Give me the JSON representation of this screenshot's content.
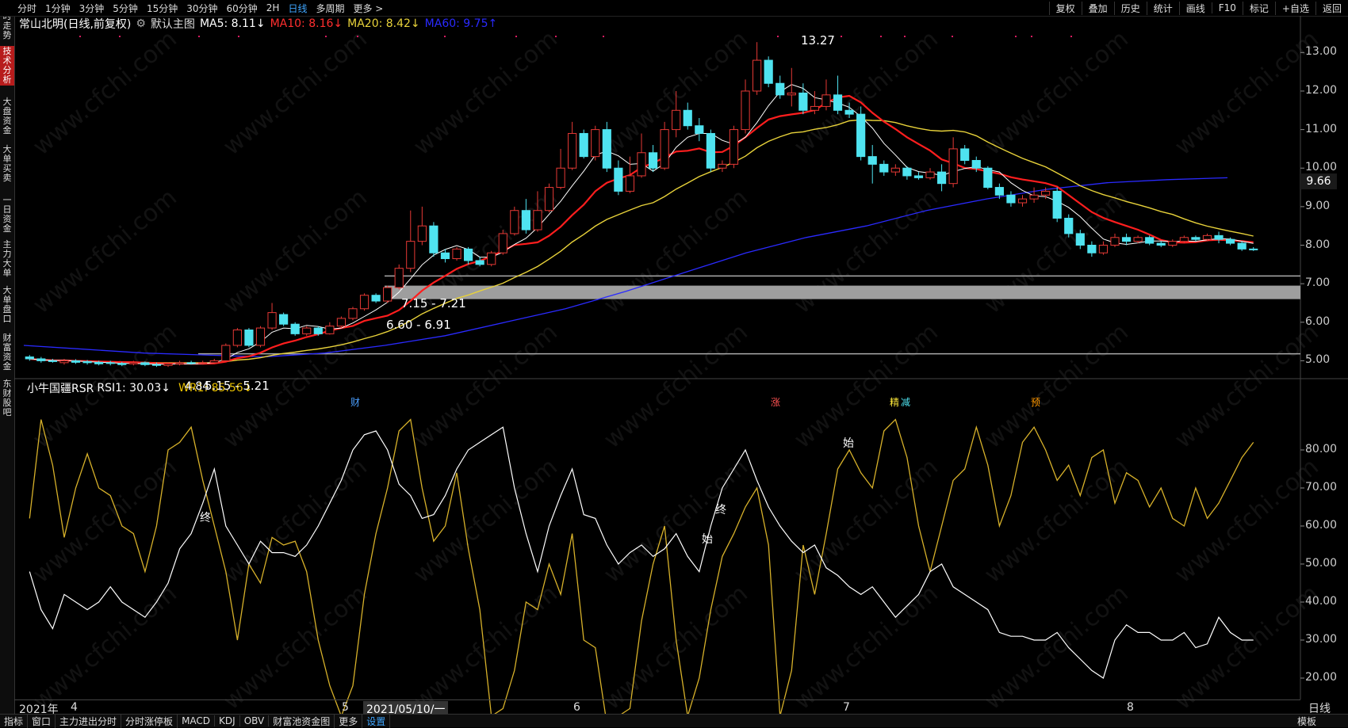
{
  "toolbar": {
    "periods": [
      "分时",
      "1分钟",
      "3分钟",
      "5分钟",
      "15分钟",
      "30分钟",
      "60分钟",
      "2H",
      "日线",
      "多周期",
      "更多 >"
    ],
    "active_period": "日线",
    "right_buttons": [
      "复权",
      "叠加",
      "历史",
      "统计",
      "画线",
      "F10",
      "标记",
      "+自选",
      "返回"
    ]
  },
  "left_tabs": [
    "分时走势",
    "技术分析",
    "大盘资金",
    "大单买卖",
    "一日资金",
    "主力大单",
    "大单盘口",
    "财富资金",
    "东财股吧"
  ],
  "left_tab_active": "技术分析",
  "info": {
    "stock": "常山北明(日线,前复权)",
    "main_chart": "默认主图",
    "ma5": "MA5: 8.11↓",
    "ma10": "MA10: 8.16↓",
    "ma20": "MA20: 8.42↓",
    "ma60": "MA60: 9.75↑"
  },
  "indicator_info": {
    "name": "小牛国疆RSR",
    "rsi1": "RSI1: 30.03↓",
    "wr1": "WR1: 85.56↓"
  },
  "price_axis": [
    "13.00",
    "12.00",
    "11.00",
    "10.00",
    "9.00",
    "8.00",
    "7.00",
    "6.00",
    "5.00"
  ],
  "current_price": "9.66",
  "indicator_axis": [
    "80.00",
    "70.00",
    "60.00",
    "50.00",
    "40.00",
    "30.00",
    "20.00"
  ],
  "annotations": {
    "high": "13.27",
    "low": "4.84",
    "zone1": "7.15 - 7.21",
    "zone2": "6.60 - 6.91",
    "zone3": "5.15 - 5.21",
    "end1": "终",
    "end2": "终",
    "start1": "始",
    "start2": "始",
    "mark_cai": "财",
    "mark_zhang": "涨",
    "mark_jing": "精",
    "mark_jian": "减",
    "mark_yu": "预"
  },
  "date_axis": {
    "year": "2021年",
    "m4": "4",
    "m5": "5",
    "current": "2021/05/10/一",
    "m6": "6",
    "m7": "7",
    "m8": "8",
    "period": "日线"
  },
  "bottom_tabs": [
    "指标",
    "窗口",
    "主力进出分时",
    "分时涨停板",
    "MACD",
    "KDJ",
    "OBV",
    "财富池资金图",
    "更多",
    "设置"
  ],
  "bottom_active": "设置",
  "templates_label": "模板",
  "watermark": "www.cfchi.com",
  "colors": {
    "up": "#e53935",
    "down": "#4fe3f0",
    "ma5": "#ffffff",
    "ma10": "#ff1e1e",
    "ma20": "#e8d23a",
    "ma60": "#2a2aff",
    "rsi": "#ffffff",
    "wr": "#d7b12a"
  },
  "chart_data": {
    "type": "candlestick",
    "price_range": [
      4.7,
      13.5
    ],
    "candles": [
      [
        5.1,
        5.05,
        5.15,
        5.0
      ],
      [
        5.05,
        5.0,
        5.1,
        4.95
      ],
      [
        5.0,
        4.98,
        5.05,
        4.95
      ],
      [
        4.95,
        5.0,
        5.05,
        4.9
      ],
      [
        5.0,
        4.96,
        5.04,
        4.92
      ],
      [
        4.98,
        4.95,
        5.02,
        4.9
      ],
      [
        4.96,
        4.92,
        5.0,
        4.88
      ],
      [
        4.95,
        4.93,
        5.0,
        4.88
      ],
      [
        4.93,
        4.9,
        4.97,
        4.86
      ],
      [
        4.92,
        4.95,
        5.0,
        4.88
      ],
      [
        4.95,
        4.9,
        4.98,
        4.86
      ],
      [
        4.9,
        4.88,
        4.95,
        4.84
      ],
      [
        4.88,
        4.92,
        4.96,
        4.84
      ],
      [
        4.92,
        4.95,
        5.0,
        4.88
      ],
      [
        4.95,
        4.93,
        5.0,
        4.9
      ],
      [
        4.93,
        4.95,
        5.0,
        4.9
      ],
      [
        4.95,
        5.0,
        5.05,
        4.92
      ],
      [
        5.0,
        5.4,
        5.45,
        4.98
      ],
      [
        5.4,
        5.8,
        5.85,
        5.35
      ],
      [
        5.8,
        5.4,
        5.85,
        5.35
      ],
      [
        5.4,
        5.85,
        5.9,
        5.35
      ],
      [
        5.85,
        6.25,
        6.5,
        5.8
      ],
      [
        6.2,
        5.95,
        6.25,
        5.9
      ],
      [
        5.95,
        5.7,
        6.0,
        5.65
      ],
      [
        5.7,
        5.85,
        5.9,
        5.65
      ],
      [
        5.85,
        5.7,
        5.9,
        5.65
      ],
      [
        5.7,
        5.9,
        6.0,
        5.68
      ],
      [
        5.9,
        6.1,
        6.15,
        5.85
      ],
      [
        6.1,
        6.35,
        6.4,
        6.05
      ],
      [
        6.35,
        6.7,
        6.75,
        6.3
      ],
      [
        6.7,
        6.55,
        6.75,
        6.5
      ],
      [
        6.55,
        6.9,
        6.95,
        6.5
      ],
      [
        6.9,
        7.4,
        7.5,
        6.85
      ],
      [
        7.4,
        8.1,
        8.9,
        7.3
      ],
      [
        8.1,
        8.5,
        9.0,
        8.0
      ],
      [
        8.5,
        7.8,
        8.6,
        7.7
      ],
      [
        7.8,
        7.65,
        7.9,
        7.55
      ],
      [
        7.65,
        7.9,
        7.95,
        7.6
      ],
      [
        7.9,
        7.6,
        7.95,
        7.5
      ],
      [
        7.6,
        7.5,
        7.7,
        7.45
      ],
      [
        7.5,
        7.8,
        7.85,
        7.45
      ],
      [
        7.8,
        8.3,
        8.4,
        7.75
      ],
      [
        8.3,
        8.9,
        9.0,
        8.25
      ],
      [
        8.9,
        8.4,
        9.2,
        8.3
      ],
      [
        8.4,
        8.9,
        9.4,
        8.35
      ],
      [
        8.9,
        9.5,
        9.6,
        8.85
      ],
      [
        9.5,
        10.0,
        10.5,
        9.45
      ],
      [
        10.0,
        10.9,
        11.2,
        9.95
      ],
      [
        10.9,
        10.3,
        11.0,
        10.25
      ],
      [
        10.3,
        11.0,
        11.1,
        10.2
      ],
      [
        11.0,
        10.0,
        11.2,
        9.9
      ],
      [
        10.0,
        9.4,
        10.2,
        9.3
      ],
      [
        9.4,
        9.8,
        10.3,
        9.35
      ],
      [
        9.8,
        10.4,
        10.9,
        9.75
      ],
      [
        10.4,
        10.0,
        10.6,
        9.9
      ],
      [
        10.0,
        11.0,
        11.2,
        9.95
      ],
      [
        11.0,
        11.5,
        12.0,
        10.8
      ],
      [
        11.5,
        11.1,
        11.7,
        11.0
      ],
      [
        11.1,
        10.9,
        11.3,
        10.7
      ],
      [
        10.9,
        10.0,
        11.0,
        9.9
      ],
      [
        10.0,
        10.1,
        10.2,
        9.9
      ],
      [
        10.1,
        11.0,
        11.1,
        10.0
      ],
      [
        11.0,
        12.0,
        12.3,
        10.9
      ],
      [
        12.0,
        12.8,
        13.27,
        11.9
      ],
      [
        12.8,
        12.2,
        12.9,
        12.1
      ],
      [
        12.2,
        11.9,
        12.4,
        11.8
      ],
      [
        11.9,
        11.95,
        12.6,
        11.6
      ],
      [
        11.95,
        11.5,
        12.2,
        11.4
      ],
      [
        11.5,
        11.6,
        12.0,
        11.4
      ],
      [
        11.6,
        11.9,
        12.3,
        11.5
      ],
      [
        11.9,
        11.5,
        12.4,
        11.4
      ],
      [
        11.5,
        11.4,
        11.7,
        11.3
      ],
      [
        11.4,
        10.3,
        11.6,
        10.2
      ],
      [
        10.3,
        10.1,
        10.6,
        9.6
      ],
      [
        10.1,
        9.9,
        10.2,
        9.8
      ],
      [
        9.9,
        10.0,
        10.1,
        9.8
      ],
      [
        10.0,
        9.8,
        10.05,
        9.7
      ],
      [
        9.8,
        9.75,
        9.9,
        9.7
      ],
      [
        9.75,
        9.9,
        10.0,
        9.7
      ],
      [
        9.9,
        9.6,
        10.1,
        9.4
      ],
      [
        9.6,
        10.5,
        10.8,
        9.5
      ],
      [
        10.5,
        10.2,
        10.6,
        10.1
      ],
      [
        10.2,
        10.0,
        10.3,
        9.9
      ],
      [
        10.0,
        9.5,
        10.05,
        9.45
      ],
      [
        9.5,
        9.3,
        9.6,
        9.2
      ],
      [
        9.3,
        9.1,
        9.4,
        9.0
      ],
      [
        9.1,
        9.2,
        9.3,
        9.0
      ],
      [
        9.2,
        9.3,
        9.5,
        9.1
      ],
      [
        9.3,
        9.4,
        9.5,
        9.2
      ],
      [
        9.4,
        8.7,
        9.5,
        8.6
      ],
      [
        8.7,
        8.3,
        8.8,
        8.2
      ],
      [
        8.3,
        8.0,
        8.4,
        7.9
      ],
      [
        8.0,
        7.8,
        8.1,
        7.7
      ],
      [
        7.8,
        8.0,
        8.1,
        7.75
      ],
      [
        8.0,
        8.2,
        8.3,
        7.95
      ],
      [
        8.2,
        8.1,
        8.3,
        8.0
      ],
      [
        8.1,
        8.2,
        8.25,
        8.05
      ],
      [
        8.2,
        8.05,
        8.25,
        8.0
      ],
      [
        8.05,
        8.0,
        8.1,
        7.95
      ],
      [
        8.0,
        8.1,
        8.15,
        7.95
      ],
      [
        8.1,
        8.2,
        8.25,
        8.05
      ],
      [
        8.2,
        8.15,
        8.25,
        8.1
      ],
      [
        8.15,
        8.25,
        8.3,
        8.1
      ],
      [
        8.25,
        8.15,
        8.35,
        8.05
      ],
      [
        8.15,
        8.05,
        8.2,
        8.0
      ],
      [
        8.05,
        7.9,
        8.1,
        7.85
      ],
      [
        7.9,
        7.88,
        7.95,
        7.85
      ]
    ],
    "ma60": [
      5.4,
      5.3,
      5.2,
      5.15,
      5.1,
      5.2,
      5.4,
      5.65,
      6.0,
      6.35,
      6.8,
      7.3,
      7.8,
      8.2,
      8.5,
      8.9,
      9.2,
      9.45,
      9.62,
      9.7,
      9.75
    ],
    "rsi": [
      48,
      38,
      33,
      42,
      40,
      38,
      40,
      44,
      40,
      38,
      36,
      40,
      45,
      54,
      58,
      66,
      75,
      60,
      55,
      50,
      56,
      53,
      53,
      52,
      55,
      60,
      66,
      72,
      80,
      84,
      85,
      80,
      71,
      68,
      62,
      63,
      68,
      75,
      80,
      82,
      84,
      86,
      70,
      58,
      48,
      60,
      68,
      75,
      63,
      62,
      55,
      50,
      53,
      55,
      52,
      54,
      58,
      52,
      48,
      60,
      70,
      75,
      80,
      72,
      65,
      60,
      56,
      53,
      55,
      49,
      47,
      44,
      42,
      44,
      40,
      36,
      39,
      42,
      48,
      50,
      44,
      42,
      40,
      38,
      32,
      31,
      31,
      30,
      30,
      32,
      28,
      25,
      22,
      20,
      30,
      34,
      32,
      32,
      30,
      30,
      32,
      28,
      29,
      36,
      32,
      30,
      30
    ],
    "wr": [
      62,
      88,
      76,
      57,
      70,
      79,
      70,
      68,
      60,
      58,
      48,
      60,
      80,
      82,
      86,
      72,
      60,
      48,
      30,
      50,
      45,
      57,
      55,
      56,
      48,
      30,
      18,
      10,
      18,
      42,
      58,
      70,
      85,
      88,
      70,
      56,
      60,
      74,
      54,
      38,
      10,
      12,
      22,
      40,
      38,
      50,
      42,
      58,
      30,
      28,
      8,
      10,
      12,
      35,
      50,
      60,
      30,
      10,
      20,
      38,
      52,
      58,
      65,
      70,
      55,
      10,
      22,
      55,
      42,
      58,
      75,
      80,
      74,
      70,
      85,
      88,
      78,
      60,
      48,
      60,
      72,
      75,
      86,
      76,
      60,
      68,
      82,
      86,
      80,
      72,
      76,
      68,
      78,
      80,
      66,
      74,
      72,
      65,
      70,
      62,
      60,
      70,
      62,
      66,
      72,
      78,
      82
    ]
  }
}
